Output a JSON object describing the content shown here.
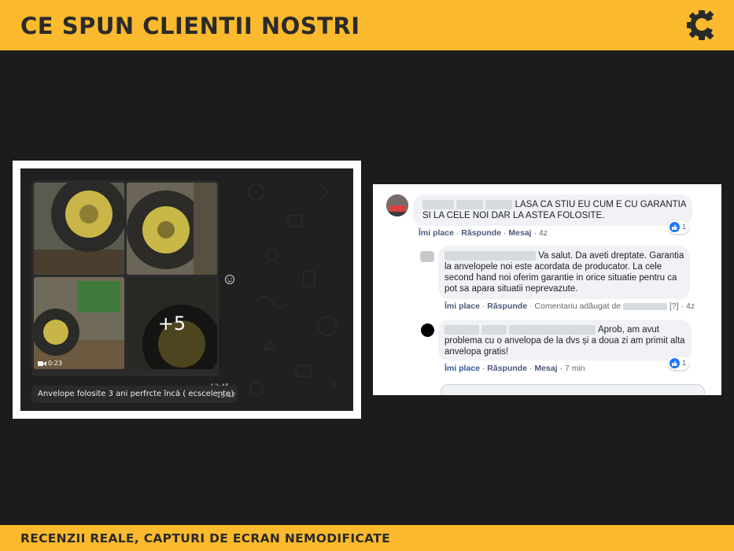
{
  "header": {
    "title": "CE SPUN CLIENTII NOSTRI",
    "logo_icon": "c-gear-logo-icon"
  },
  "footer": {
    "title": "RECENZII REALE, CAPTURI DE ECRAN NEMODIFICATE"
  },
  "chat": {
    "video_duration": "0:23",
    "more_count": "+5",
    "photos_time": "13:45",
    "caption": "Anvelope folosite 3 ani perfrcte încă ( ecscelente)",
    "caption_time": "13:47",
    "emoji_icon": "smiley-icon"
  },
  "comments": [
    {
      "text_line1": "LASA CA STIU EU CUM E CU GARANTIA",
      "text_line2": "SI LA CELE NOI DAR LA ASTEA FOLOSITE.",
      "like": "Îmi place",
      "reply": "Răspunde",
      "message": "Mesaj",
      "time": "4z",
      "reactions": "1"
    },
    {
      "text_line1": "Va salut. Da aveti dreptate. Garantia",
      "text_line2": "la anvelopele noi este acordata de producator. La cele",
      "text_line3": "second hand noi oferim garantie in orice situatie pentru ca",
      "text_line4": "pot sa apara situatii neprevazute.",
      "like": "Îmi place",
      "reply": "Răspunde",
      "added": "Comentariu adăugat de",
      "added_suffix": "[?]",
      "time": "4z"
    },
    {
      "text_line1": "Aprob, am avut",
      "text_line2": "problema cu o anvelopa de la dvs și a doua zi am primit alta",
      "text_line3": "anvelopa gratis!",
      "like": "Îmi place",
      "reply": "Răspunde",
      "message": "Mesaj",
      "time": "7 min",
      "reactions": "1"
    }
  ],
  "colors": {
    "accent": "#fbba2d",
    "background": "#1c1c1c",
    "fb_link": "#385898",
    "fb_like": "#1877f2"
  }
}
